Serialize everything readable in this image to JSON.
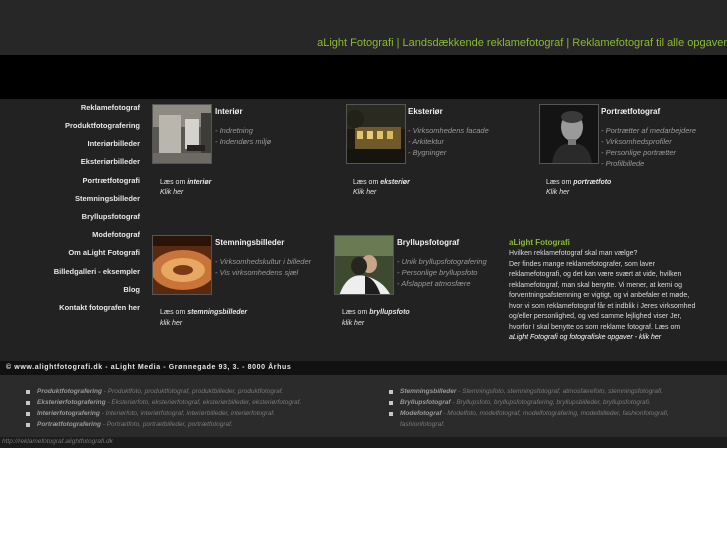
{
  "header": {
    "tagline": "aLight Fotografi | Landsdækkende reklamefotograf | Reklamefotograf til alle opgaver"
  },
  "nav": [
    "Reklamefotograf",
    "Produktfotografering",
    "Interiørbilleder",
    "Eksteriørbilleder",
    "Portrætfotografi",
    "Stemningsbilleder",
    "Bryllupsfotograf",
    "Modefotograf",
    "Om aLight Fotografi",
    "Billedgalleri - eksempler",
    "Blog",
    "Kontakt fotografen her"
  ],
  "blocks": {
    "interior": {
      "title": "Interiør",
      "items": [
        "- Indretning",
        "- Indendørs miljø"
      ],
      "laes_prefix": "Læs om ",
      "laes_subject": "interiør",
      "klik": "Klik her"
    },
    "exterior": {
      "title": "Eksteriør",
      "items": [
        "- Virksomhedens facade",
        "- Arkitektur",
        "- Bygninger"
      ],
      "laes_prefix": "Læs om ",
      "laes_subject": "eksteriør",
      "klik": "Klik her"
    },
    "portrait": {
      "title": "Portrætfotograf",
      "items": [
        "- Portrætter af medarbejdere",
        "- Virksomhedsprofiler",
        "- Personlige portrætter",
        "- Profilbillede"
      ],
      "laes_prefix": "Læs om ",
      "laes_subject": "portrætfoto",
      "klik": "Klik her"
    },
    "mood": {
      "title": "Stemningsbilleder",
      "items": [
        "- Virksomhedskultur i billeder",
        "- Vis virksomhedens sjæl"
      ],
      "laes_prefix": "Læs om ",
      "laes_subject": "stemningsbilleder",
      "klik": "klik her"
    },
    "wedding": {
      "title": "Bryllupsfotograf",
      "items": [
        "- Unik bryllupsfotografering",
        "- Personlige bryllupsfoto",
        "- Afslappet atmosfære"
      ],
      "laes_prefix": "Læs om ",
      "laes_subject": "bryllupsfoto",
      "klik": "klik her"
    }
  },
  "alight": {
    "title": "aLight Fotografi",
    "lines": [
      "Hvilken reklamefotograf skal man vælge?",
      "Der findes mange reklamefotografer, som laver",
      "reklamefotografi, og det kan være svært at vide, hvilken",
      "reklamefotograf, man skal benytte. Vi mener, at kemi og",
      "forventningsafstemning er vigtigt, og vi anbefaler et møde,",
      "hvor vi som reklamefotograf får et indblik i Jeres virksomhed",
      "og/eller personlighed, og ved samme lejlighed viser Jer,",
      "hvorfor I skal benytte os som reklame fotograf. Læs om",
      "aLight Fotografi og fotografiske opgaver - klik her"
    ]
  },
  "footer": {
    "text": "© www.alightfotografi.dk - aLight Media - Grønnegade 93, 3. - 8000 Århus"
  },
  "seo_left": [
    {
      "bold": "Produktfotografering",
      "rest": " - Produktfoto, produktfotograf, produktbilleder, produktfotograf."
    },
    {
      "bold": "Eksteriørfotografering",
      "rest": " - Eksteriørfoto, eksteriørfotograf, eksteriørbilleder, eksteriørfotograf."
    },
    {
      "bold": "Interiørfotografering",
      "rest": " - Interiørfoto, interiørfotograf, interiørbilleder, interiørfotograf."
    },
    {
      "bold": "Portrætfotografering",
      "rest": " - Portrætfoto, portrætbilleder, portrætfotograf."
    }
  ],
  "seo_right": [
    {
      "bold": "Stemningsbilleder",
      "rest": " - Stemningsfoto, stemningsfotograf, atmosfærefoto, stemningsfotografi."
    },
    {
      "bold": "Bryllupsfotograf",
      "rest": " - Bryllupsfoto, bryllupsfotografering, bryllupsbilleder, bryllupsfotografi."
    },
    {
      "bold": "Modefotograf",
      "rest": " - Modelfoto, modelfotograf, modelfotografering, modelbilleder, fashionfotografi,"
    },
    {
      "bold": "",
      "rest": "fashionfotograf."
    }
  ],
  "statusbar": {
    "url": "http://reklamefotograf.alightfotografi.dk"
  }
}
